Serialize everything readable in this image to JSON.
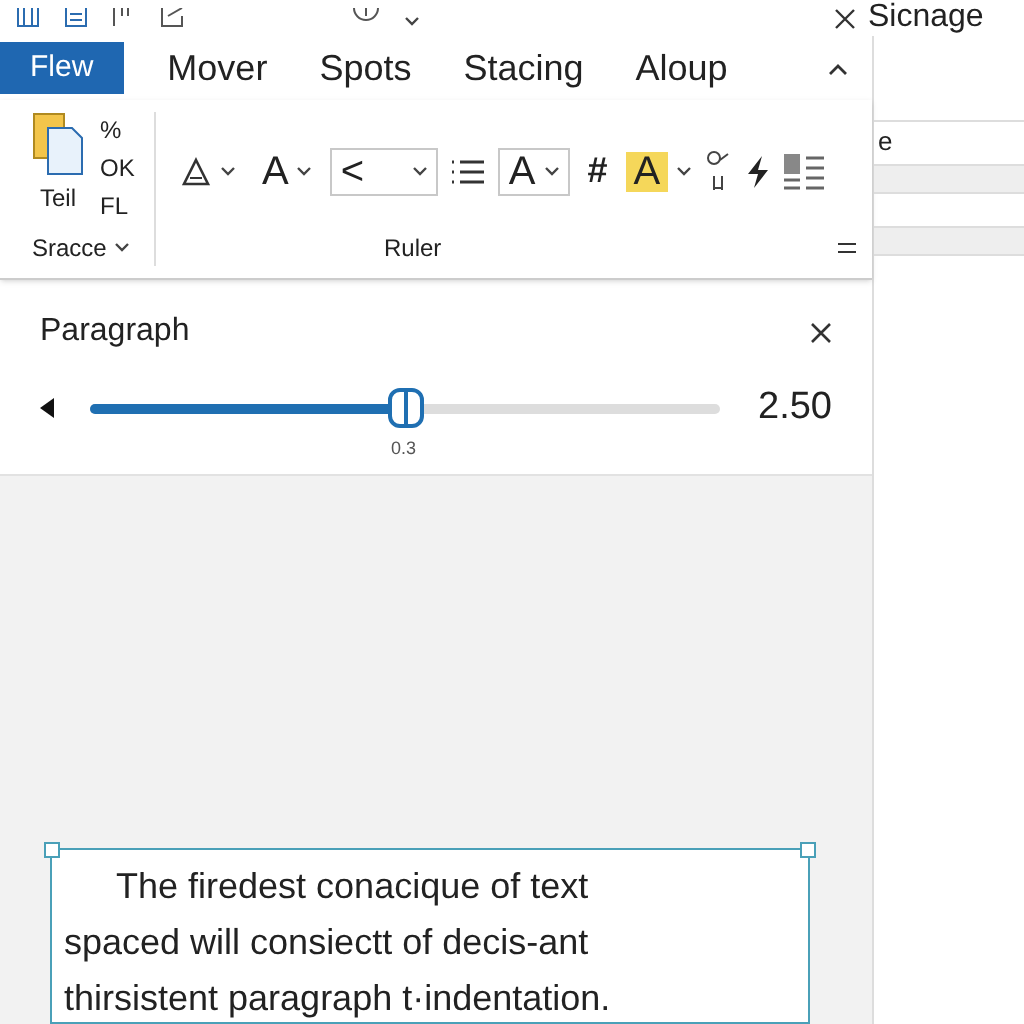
{
  "tabs": [
    {
      "label": "Flew",
      "selected": true
    },
    {
      "label": "Mover",
      "selected": false
    },
    {
      "label": "Spots",
      "selected": false
    },
    {
      "label": "Stacing",
      "selected": false
    },
    {
      "label": "Aloup",
      "selected": false
    }
  ],
  "ribbon": {
    "clipboard": {
      "label": "Sracce",
      "paste_label": "Teil",
      "small_items": [
        "%",
        "OK",
        "FL"
      ]
    },
    "ruler": {
      "label": "Ruler",
      "tools": [
        {
          "kind": "icon-dropdown"
        },
        {
          "kind": "text-dropdown",
          "text": "A"
        },
        {
          "kind": "combo",
          "text": "<"
        },
        {
          "kind": "list"
        },
        {
          "kind": "box-dropdown",
          "text": "A"
        },
        {
          "kind": "glyph",
          "text": "#"
        },
        {
          "kind": "highlight",
          "text": "A",
          "highlighted": true
        },
        {
          "kind": "link"
        },
        {
          "kind": "bolt"
        },
        {
          "kind": "layout"
        }
      ]
    }
  },
  "side_pane": {
    "title": "Sicnage",
    "rows": [
      {
        "kind": "text",
        "text": "e"
      },
      {
        "kind": "blank"
      },
      {
        "kind": "spacer"
      },
      {
        "kind": "blank"
      }
    ]
  },
  "paragraph_panel": {
    "title": "Paragraph",
    "slider": {
      "level": 0.5,
      "thumb_label": "0.3"
    },
    "reading": "2.50"
  },
  "text_box": {
    "lines": [
      "The firedest conacique of text",
      "spaced will consiectt of decis-ant",
      "thirsistent paragraph t·indentation."
    ]
  }
}
